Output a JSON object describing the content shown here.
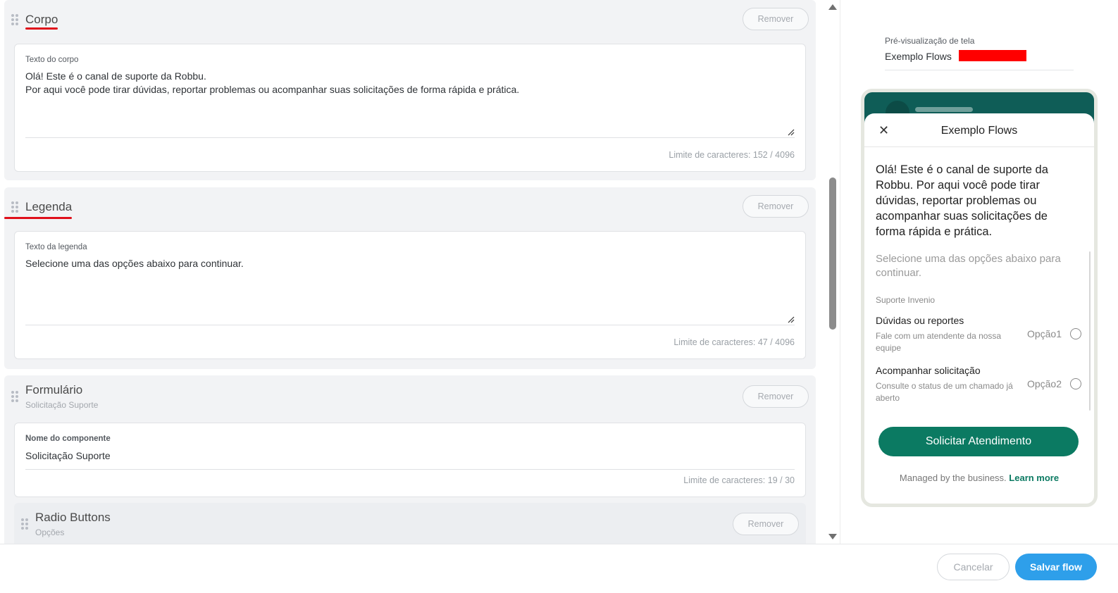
{
  "editor": {
    "remove_label": "Remover",
    "counter_prefix": "Limite de caracteres:",
    "corpo": {
      "title": "Corpo",
      "field_label": "Texto do corpo",
      "field_value": "Olá! Este é o canal de suporte da Robbu.\nPor aqui você pode tirar dúvidas, reportar problemas ou acompanhar suas solicitações de forma rápida e prática.",
      "counter": "152 / 4096"
    },
    "legenda": {
      "title": "Legenda",
      "field_label": "Texto da legenda",
      "field_value": "Selecione uma das opções abaixo para continuar.",
      "counter": "47 / 4096"
    },
    "formulario": {
      "title": "Formulário",
      "subtitle": "Solicitação Suporte",
      "field_label": "Nome do componente",
      "field_value": "Solicitação Suporte",
      "counter": "19 / 30"
    },
    "radio_buttons": {
      "title": "Radio Buttons",
      "subtitle": "Opções"
    }
  },
  "preview": {
    "label": "Pré-visualização de tela",
    "screen_name": "Exemplo Flows",
    "sheet": {
      "title": "Exemplo Flows",
      "body": "Olá! Este é o canal de suporte da Robbu. Por aqui você pode tirar dúvidas, reportar problemas ou acompanhar suas solicitações de forma rápida e prática.",
      "caption": "Selecione uma das opções abaixo para continuar.",
      "group_label": "Suporte Invenio",
      "options": [
        {
          "title": "Dúvidas ou reportes",
          "description": "Fale com um atendente da nossa equipe",
          "value": "Opção1"
        },
        {
          "title": "Acompanhar solicitação",
          "description": "Consulte o status de um chamado já aberto",
          "value": "Opção2"
        }
      ],
      "cta_label": "Solicitar Atendimento",
      "managed_text": "Managed by the business.",
      "learn_more": "Learn more"
    }
  },
  "footer": {
    "cancel_label": "Cancelar",
    "save_label": "Salvar flow"
  },
  "colors": {
    "accent_blue": "#2e9fea",
    "whatsapp_green": "#0b7a62",
    "header_teal": "#0f5d57",
    "annotation_red": "#e0101b",
    "redaction_red": "#ff0000"
  }
}
